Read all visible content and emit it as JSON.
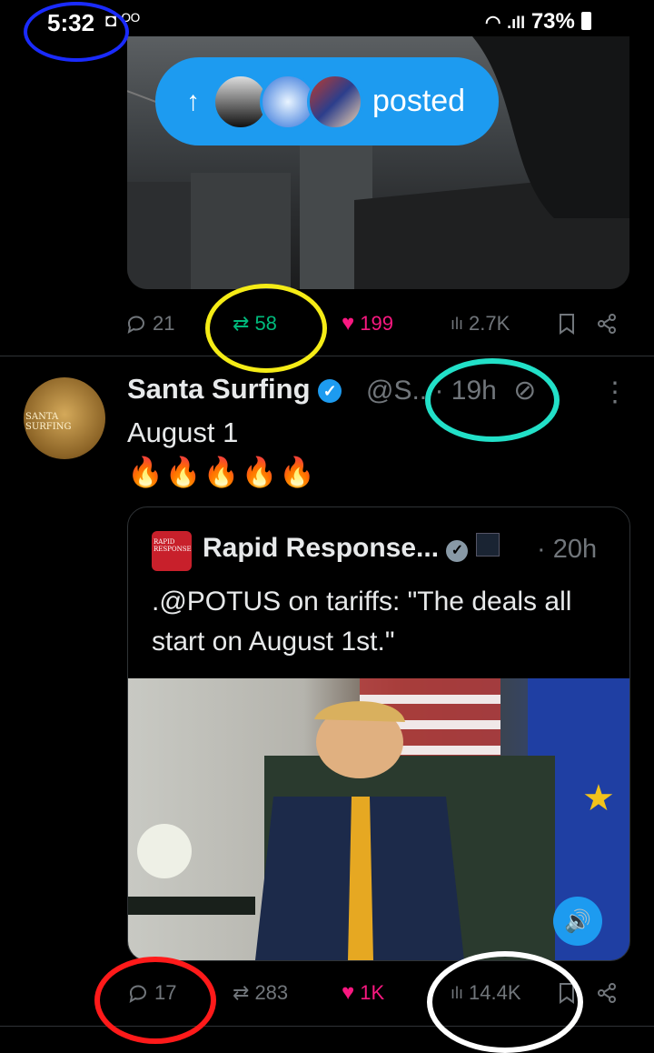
{
  "status_bar": {
    "time": "5:32",
    "battery": "73%",
    "icons": [
      "notification-icon",
      "voicemail-icon",
      "wifi-icon",
      "signal-icon",
      "battery-icon"
    ]
  },
  "posted_pill": {
    "label": "posted",
    "arrow": "↑"
  },
  "tweet1_actions": {
    "replies": "21",
    "reposts": "58",
    "likes": "199",
    "views": "2.7K"
  },
  "tweet2": {
    "name": "Santa Surfing",
    "handle": "@S..",
    "time": "· 19h",
    "text": "August 1",
    "fires": "🔥🔥🔥🔥🔥",
    "avatar_text": "SANTA SURFING"
  },
  "quote": {
    "name": "Rapid Response...",
    "time": "· 20h",
    "text": ".@POTUS on tariffs: \"The deals all start on August 1st.\"",
    "avatar_text": "RAPID RESPONSE"
  },
  "tweet2_actions": {
    "replies": "17",
    "reposts": "283",
    "likes": "1K",
    "views": "14.4K"
  },
  "colors": {
    "accent": "#1d9bf0",
    "like": "#f91880",
    "repost": "#00ba7c",
    "muted": "#71767b"
  }
}
